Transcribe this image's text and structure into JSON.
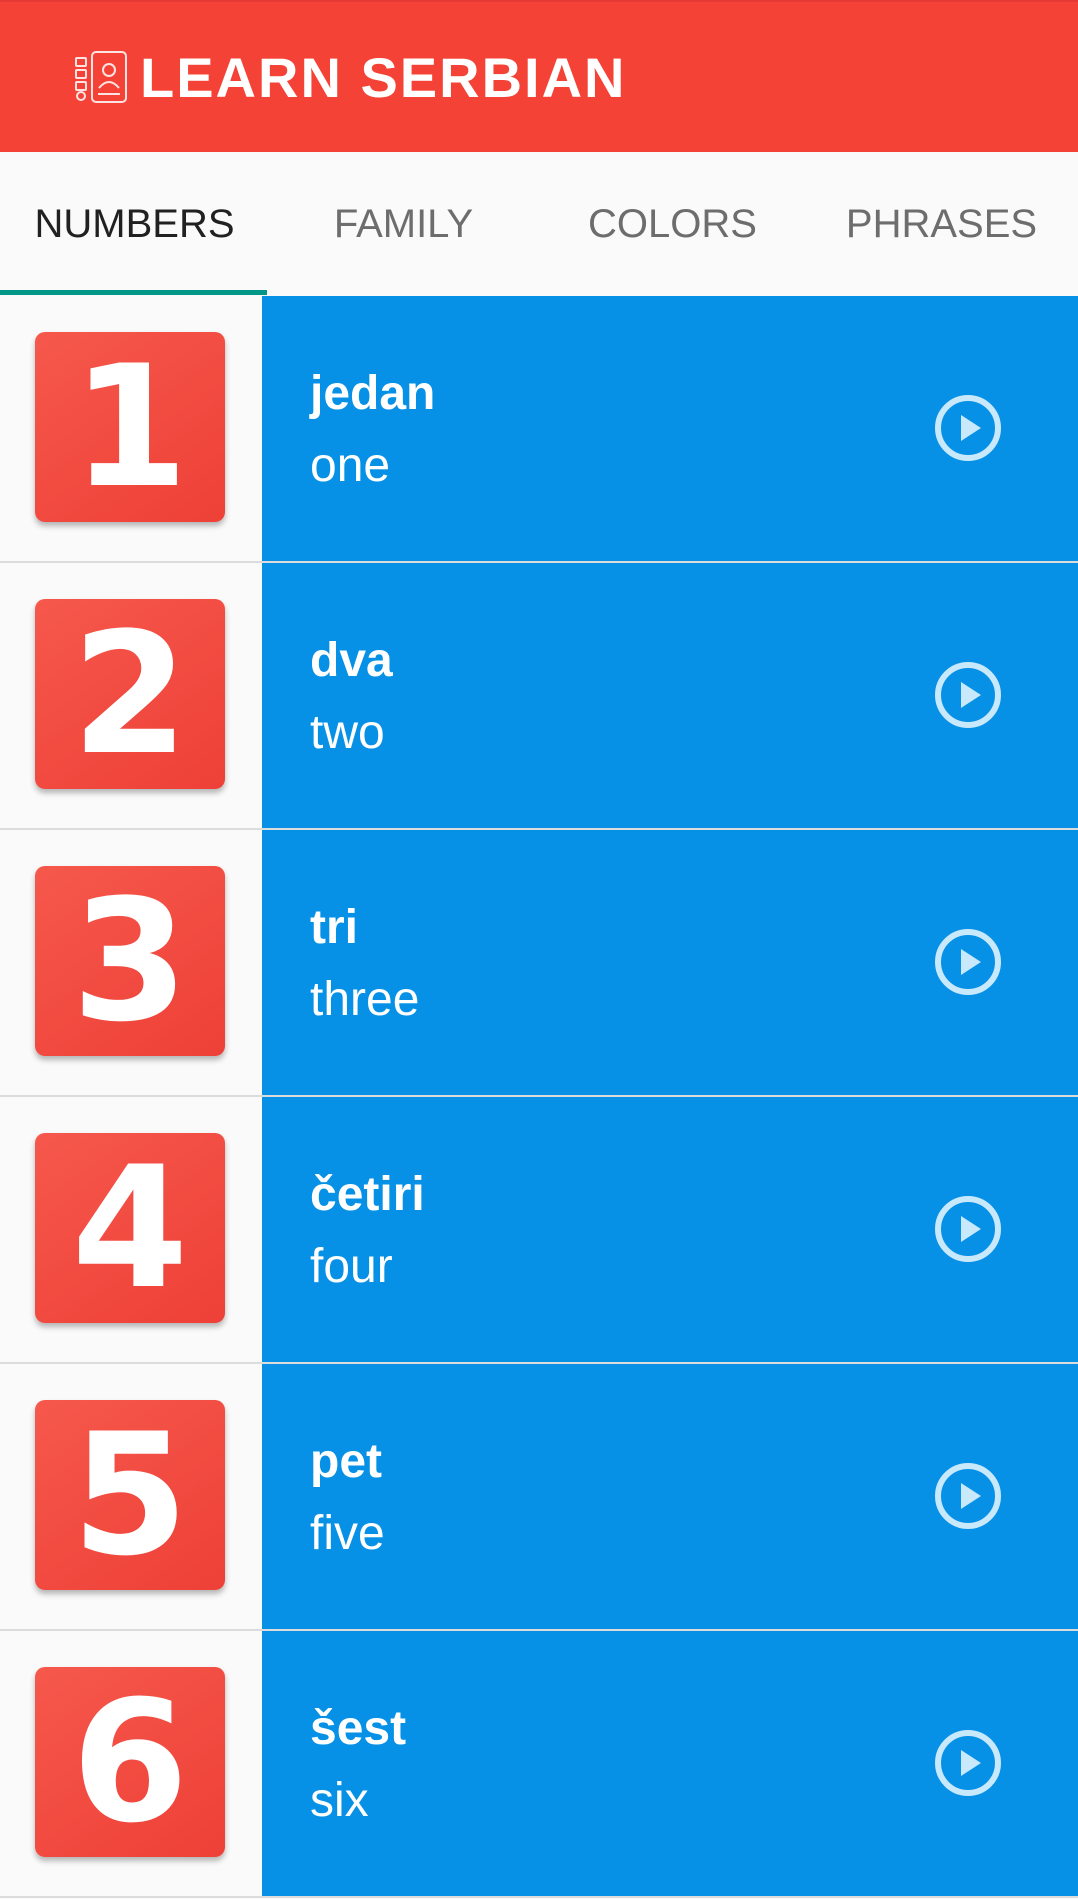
{
  "app_bar": {
    "title": "LEARN SERBIAN",
    "logo_icon": "phone-tutor-icon",
    "color": "#f44336"
  },
  "tabs": [
    {
      "label": "NUMBERS",
      "active": true
    },
    {
      "label": "FAMILY",
      "active": false
    },
    {
      "label": "COLORS",
      "active": false
    },
    {
      "label": "PHRASES",
      "active": false
    }
  ],
  "tab_indicator_color": "#009688",
  "list": {
    "item_background": "#0791e6",
    "tile_color": "#f44336",
    "play_icon": "play-circle-icon",
    "items": [
      {
        "number": "1",
        "serbian": "jedan",
        "english": "one"
      },
      {
        "number": "2",
        "serbian": "dva",
        "english": "two"
      },
      {
        "number": "3",
        "serbian": "tri",
        "english": "three"
      },
      {
        "number": "4",
        "serbian": "četiri",
        "english": "four"
      },
      {
        "number": "5",
        "serbian": "pet",
        "english": "five"
      },
      {
        "number": "6",
        "serbian": "šest",
        "english": "six"
      }
    ]
  }
}
